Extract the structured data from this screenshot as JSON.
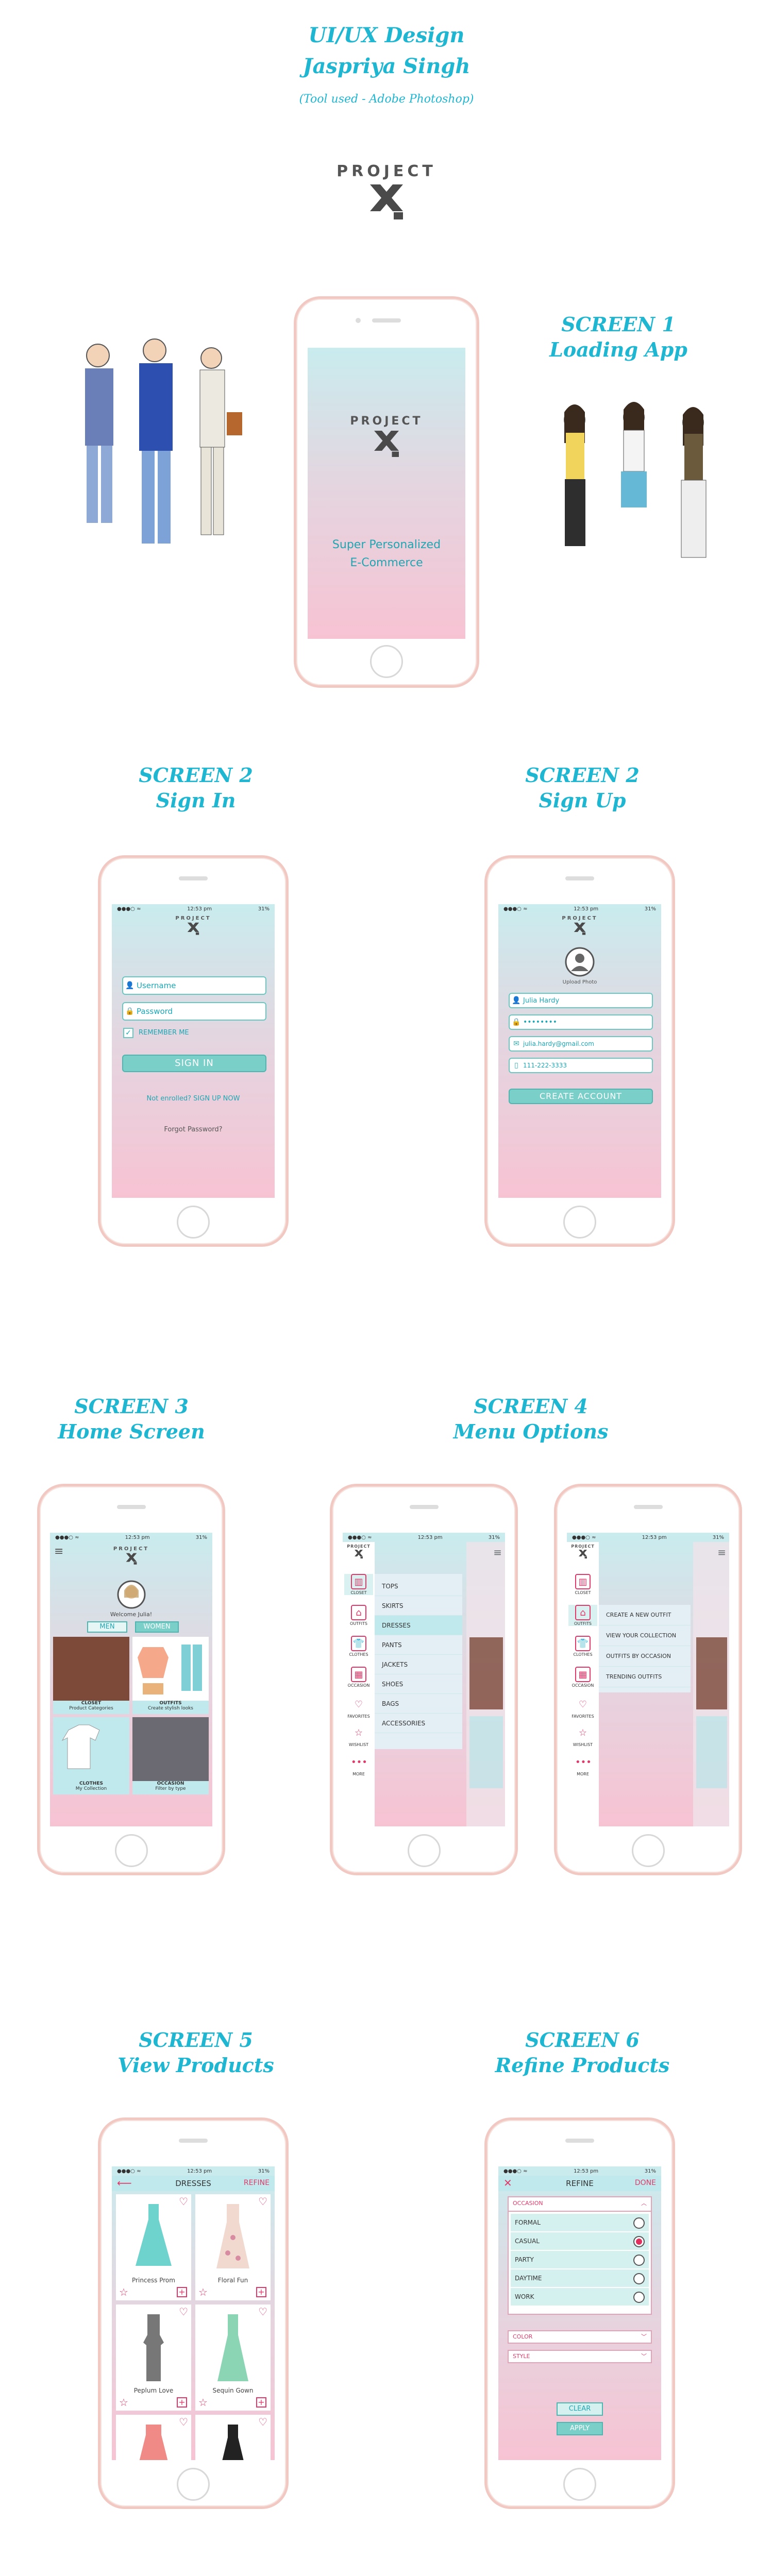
{
  "header": {
    "title": "UI/UX Design",
    "author": "Jaspriya Singh",
    "tool": "(Tool used - Adobe Photoshop)",
    "brand": "PROJECT"
  },
  "colors": {
    "accent": "#1fb6d1",
    "teal": "#7bcfc9",
    "pink": "#e03a6a",
    "phone_frame": "#f1c8c2"
  },
  "screen1": {
    "label": "SCREEN 1",
    "sublabel": "Loading App",
    "logo": "PROJECT",
    "tagline1": "Super Personalized",
    "tagline2": "E-Commerce"
  },
  "screen2a": {
    "label": "SCREEN 2",
    "sublabel": "Sign In",
    "time": "12:53 pm",
    "battery": "31%",
    "logo": "PROJECT",
    "username_placeholder": "Username",
    "password_placeholder": "Password",
    "remember": "REMEMBER ME",
    "signin": "SIGN IN",
    "not_enrolled": "Not enrolled? SIGN UP NOW",
    "forgot": "Forgot Password?"
  },
  "screen2b": {
    "label": "SCREEN 2",
    "sublabel": "Sign Up",
    "time": "12:53 pm",
    "battery": "31%",
    "logo": "PROJECT",
    "upload": "Upload Photo",
    "name": "Julia Hardy",
    "password": "••••••••",
    "email": "julia.hardy@gmail.com",
    "phone": "111-222-3333",
    "create": "CREATE ACCOUNT"
  },
  "screen3": {
    "label": "SCREEN 3",
    "sublabel": "Home Screen",
    "time": "12:53 pm",
    "battery": "31%",
    "logo": "PROJECT",
    "welcome": "Welcome Julia!",
    "men": "MEN",
    "women": "WOMEN",
    "tiles": [
      {
        "title": "CLOSET",
        "sub": "Product Categories"
      },
      {
        "title": "OUTFITS",
        "sub": "Create stylish looks"
      },
      {
        "title": "CLOTHES",
        "sub": "My Collection"
      },
      {
        "title": "OCCASION",
        "sub": "Filter by type"
      }
    ]
  },
  "screen4": {
    "label": "SCREEN 4",
    "sublabel": "Menu Options",
    "time": "12:53 pm",
    "battery": "31%",
    "logo": "PROJECT",
    "icons": [
      "CLOSET",
      "OUTFITS",
      "CLOTHES",
      "OCCASION",
      "FAVORITES",
      "WISHLIST",
      "MORE"
    ],
    "closet_items": [
      "TOPS",
      "SKIRTS",
      "DRESSES",
      "PANTS",
      "JACKETS",
      "SHOES",
      "BAGS",
      "ACCESSORIES"
    ],
    "outfit_items": [
      "CREATE A NEW OUTFIT",
      "VIEW YOUR COLLECTION",
      "OUTFITS BY OCCASION",
      "TRENDING OUTFITS"
    ]
  },
  "screen5": {
    "label": "SCREEN 5",
    "sublabel": "View Products",
    "time": "12:53 pm",
    "battery": "31%",
    "title": "DRESSES",
    "refine": "REFINE",
    "products": [
      "Princess Prom",
      "Floral Fun",
      "Peplum Love",
      "Sequin Gown"
    ]
  },
  "screen6": {
    "label": "SCREEN 6",
    "sublabel": "Refine Products",
    "time": "12:53 pm",
    "battery": "31%",
    "title": "REFINE",
    "done": "DONE",
    "occasion": "OCCASION",
    "options": [
      "FORMAL",
      "CASUAL",
      "PARTY",
      "DAYTIME",
      "WORK"
    ],
    "color": "COLOR",
    "style": "STYLE",
    "clear": "CLEAR",
    "apply": "APPLY"
  }
}
